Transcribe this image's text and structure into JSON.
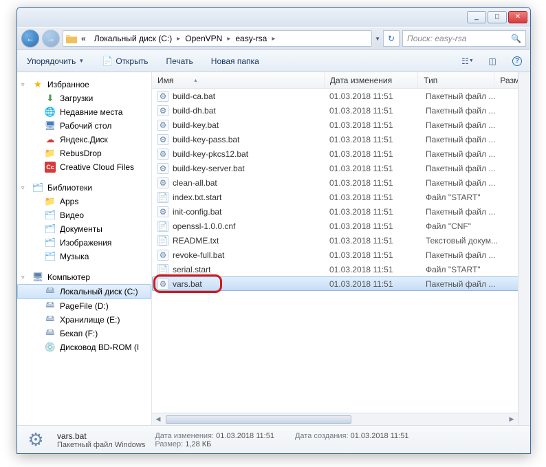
{
  "titlebar": {
    "min": "_",
    "max": "□",
    "close": "✕"
  },
  "address": {
    "segHome": "«",
    "seg1": "Локальный диск (C:)",
    "seg2": "OpenVPN",
    "seg3": "easy-rsa",
    "searchPlaceholder": "Поиск: easy-rsa"
  },
  "toolbar": {
    "organize": "Упорядочить",
    "open": "Открыть",
    "print": "Печать",
    "newfolder": "Новая папка"
  },
  "columns": {
    "name": "Имя",
    "date": "Дата изменения",
    "type": "Тип",
    "size": "Разме"
  },
  "sidebar": {
    "favorites": "Избранное",
    "fav_items": [
      {
        "label": "Загрузки",
        "icon": "dl"
      },
      {
        "label": "Недавние места",
        "icon": "globe"
      },
      {
        "label": "Рабочий стол",
        "icon": "desk"
      },
      {
        "label": "Яндекс.Диск",
        "icon": "y"
      },
      {
        "label": "RebusDrop",
        "icon": "folder"
      },
      {
        "label": "Creative Cloud Files",
        "icon": "cc"
      }
    ],
    "libraries": "Библиотеки",
    "lib_items": [
      {
        "label": "Apps",
        "icon": "folder"
      },
      {
        "label": "Видео",
        "icon": "folder-lib"
      },
      {
        "label": "Документы",
        "icon": "folder-lib"
      },
      {
        "label": "Изображения",
        "icon": "folder-lib"
      },
      {
        "label": "Музыка",
        "icon": "folder-lib"
      }
    ],
    "computer": "Компьютер",
    "comp_items": [
      {
        "label": "Локальный диск (C:)",
        "icon": "drive",
        "selected": true
      },
      {
        "label": "PageFile (D:)",
        "icon": "drive"
      },
      {
        "label": "Хранилище (E:)",
        "icon": "drive"
      },
      {
        "label": "Бекап (F:)",
        "icon": "drive"
      },
      {
        "label": "Дисковод BD-ROM (I",
        "icon": "disc"
      }
    ]
  },
  "files": [
    {
      "name": "build-ca.bat",
      "date": "01.03.2018 11:51",
      "type": "Пакетный файл ...",
      "icon": "bat"
    },
    {
      "name": "build-dh.bat",
      "date": "01.03.2018 11:51",
      "type": "Пакетный файл ...",
      "icon": "bat"
    },
    {
      "name": "build-key.bat",
      "date": "01.03.2018 11:51",
      "type": "Пакетный файл ...",
      "icon": "bat"
    },
    {
      "name": "build-key-pass.bat",
      "date": "01.03.2018 11:51",
      "type": "Пакетный файл ...",
      "icon": "bat"
    },
    {
      "name": "build-key-pkcs12.bat",
      "date": "01.03.2018 11:51",
      "type": "Пакетный файл ...",
      "icon": "bat"
    },
    {
      "name": "build-key-server.bat",
      "date": "01.03.2018 11:51",
      "type": "Пакетный файл ...",
      "icon": "bat"
    },
    {
      "name": "clean-all.bat",
      "date": "01.03.2018 11:51",
      "type": "Пакетный файл ...",
      "icon": "bat"
    },
    {
      "name": "index.txt.start",
      "date": "01.03.2018 11:51",
      "type": "Файл \"START\"",
      "icon": "txt"
    },
    {
      "name": "init-config.bat",
      "date": "01.03.2018 11:51",
      "type": "Пакетный файл ...",
      "icon": "bat"
    },
    {
      "name": "openssl-1.0.0.cnf",
      "date": "01.03.2018 11:51",
      "type": "Файл \"CNF\"",
      "icon": "txt"
    },
    {
      "name": "README.txt",
      "date": "01.03.2018 11:51",
      "type": "Текстовый докум...",
      "icon": "txt"
    },
    {
      "name": "revoke-full.bat",
      "date": "01.03.2018 11:51",
      "type": "Пакетный файл ...",
      "icon": "bat"
    },
    {
      "name": "serial.start",
      "date": "01.03.2018 11:51",
      "type": "Файл \"START\"",
      "icon": "txt"
    },
    {
      "name": "vars.bat",
      "date": "01.03.2018 11:51",
      "type": "Пакетный файл ...",
      "icon": "bat",
      "selected": true,
      "highlight": true
    }
  ],
  "details": {
    "filename": "vars.bat",
    "subtitle": "Пакетный файл Windows",
    "mod_label": "Дата изменения:",
    "mod_value": "01.03.2018 11:51",
    "size_label": "Размер:",
    "size_value": "1,28 КБ",
    "created_label": "Дата создания:",
    "created_value": "01.03.2018 11:51"
  }
}
